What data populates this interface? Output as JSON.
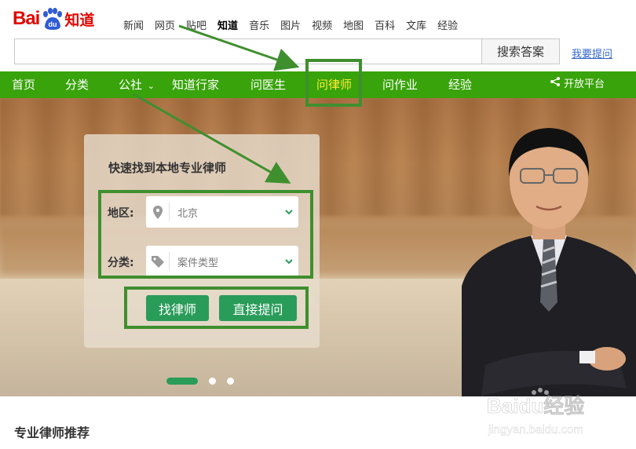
{
  "brand": {
    "logo_left": "Bai",
    "logo_paw": "du",
    "logo_right": "知道"
  },
  "topnav": [
    "新闻",
    "网页",
    "贴吧",
    "知道",
    "音乐",
    "图片",
    "视频",
    "地图",
    "百科",
    "文库",
    "经验"
  ],
  "search": {
    "button": "搜索答案",
    "ask_link": "我要提问",
    "value": ""
  },
  "greennav": {
    "items": [
      "首页",
      "分类",
      "公社",
      "知道行家",
      "问医生",
      "问律师",
      "问作业",
      "经验"
    ],
    "active_index": 5,
    "open_platform": "开放平台"
  },
  "finder": {
    "title": "快速找到本地专业律师",
    "region_label": "地区:",
    "region_value": "北京",
    "category_label": "分类:",
    "category_value": "案件类型",
    "find_button": "找律师",
    "ask_button": "直接提问"
  },
  "carousel": {
    "slides": 3,
    "active": 1
  },
  "section": {
    "title": "专业律师推荐"
  },
  "watermark": {
    "brand": "Baidu经验",
    "url": "jingyan.baidu.com"
  },
  "colors": {
    "brand_red": "#e10601",
    "nav_green": "#38a30a",
    "button_green": "#2a9c5a",
    "active_yellow": "#ffee33",
    "annotation_green": "#3f8f2e",
    "link_blue": "#3366cc"
  }
}
